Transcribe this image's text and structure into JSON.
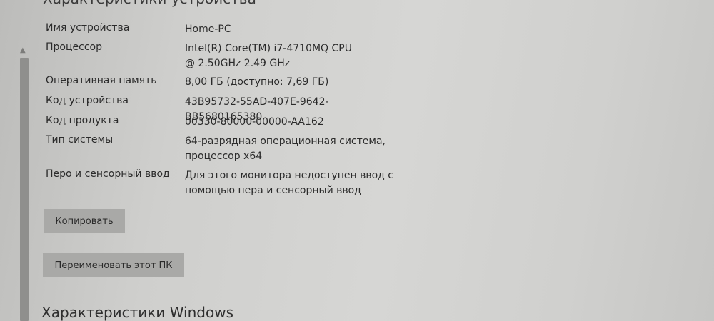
{
  "section_top": {
    "title": "Характеристики устройства"
  },
  "specs": [
    {
      "label": "Имя устройства",
      "value": "Home-PC"
    },
    {
      "label": "Процессор",
      "value": "Intel(R) Core(TM) i7-4710MQ CPU @ 2.50GHz   2.49 GHz"
    },
    {
      "label": "Оперативная память",
      "value": "8,00 ГБ (доступно: 7,69 ГБ)"
    },
    {
      "label": "Код устройства",
      "value": "43B95732-55AD-407E-9642-BB5680165380"
    },
    {
      "label": "Код продукта",
      "value": "00330-80000-00000-AA162"
    },
    {
      "label": "Тип системы",
      "value": "64-разрядная операционная система, процессор x64"
    },
    {
      "label": "Перо и сенсорный ввод",
      "value": "Для этого монитора недоступен ввод с помощью пера и сенсорный ввод"
    }
  ],
  "buttons": {
    "copy_label": "Копировать",
    "rename_label": "Переименовать этот ПК"
  },
  "section_bottom": {
    "title": "Характеристики Windows"
  },
  "icons": {
    "scroll_up": "chevron-up-icon"
  }
}
